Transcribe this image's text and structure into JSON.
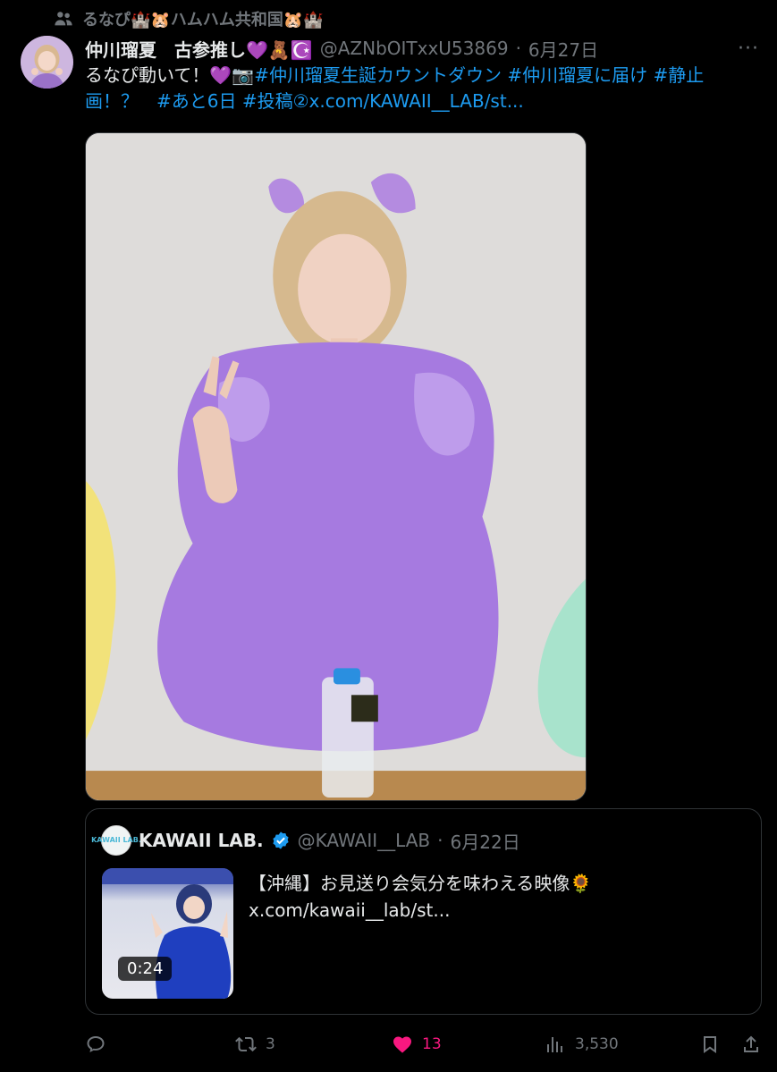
{
  "social_context": {
    "icon": "people-icon",
    "text": "るなぴ🏰🐹ハムハム共和国🐹🏰"
  },
  "author": {
    "display_name": "仲川瑠夏　古参推し💜🧸☪️",
    "handle": "@AZNbOITxxU53869",
    "date": "6月27日"
  },
  "more_label": "···",
  "tweet_text": {
    "plain": "るなぴ動いて！💜📷",
    "hashtags": "#仲川瑠夏生誕カウントダウン #仲川瑠夏に届け #静止画！？　#あと6日 #投稿②x.com/KAWAII__LAB/st..."
  },
  "quote": {
    "avatar_text": "KAWAII LAB.",
    "name": "KAWAII LAB.",
    "verified_icon": "verified-badge-icon",
    "handle": "@KAWAII__LAB",
    "date": "6月22日",
    "text": "【沖縄】お見送り会気分を味わえる映像🌻 x.com/kawaii__lab/st...",
    "video_duration": "0:24"
  },
  "actions": {
    "reply": {
      "icon": "reply-icon",
      "count": ""
    },
    "repost": {
      "icon": "repost-icon",
      "count": "3"
    },
    "like": {
      "icon": "heart-icon",
      "count": "13",
      "active": true
    },
    "views": {
      "icon": "views-icon",
      "count": "3,530"
    },
    "bookmark": {
      "icon": "bookmark-icon"
    },
    "share": {
      "icon": "share-icon"
    }
  },
  "colors": {
    "background": "#000000",
    "text": "#e7e9ea",
    "muted": "#71767b",
    "link": "#1d9bf0",
    "like": "#f91880",
    "border": "#2f3336"
  }
}
